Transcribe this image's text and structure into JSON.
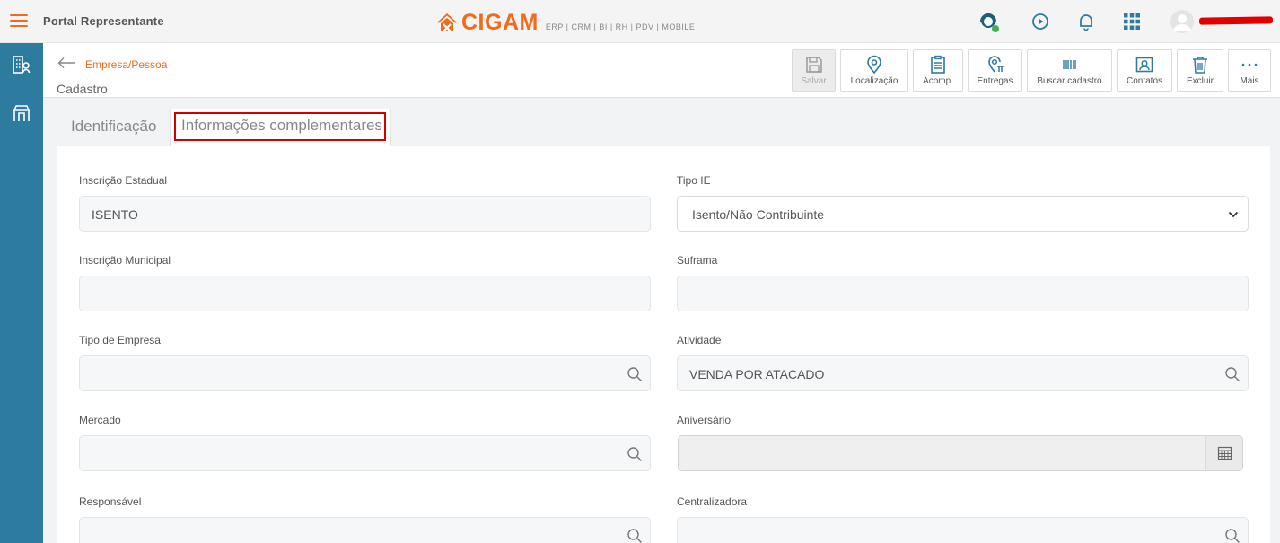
{
  "app": {
    "title": "Portal Representante",
    "logo_text": "CIGAM",
    "logo_sub": "ERP | CRM | BI | RH | PDV | MOBILE",
    "brand_color": "#f26a1b",
    "sidebar_color": "#2d7ca0"
  },
  "header": {
    "breadcrumb": "Empresa/Pessoa",
    "subtitle": "Cadastro"
  },
  "toolbar": {
    "save": "Salvar",
    "location": "Localização",
    "acomp": "Acomp.",
    "deliveries": "Entregas",
    "search_register": "Buscar cadastro",
    "contacts": "Contatos",
    "delete": "Excluir",
    "more": "Mais"
  },
  "tabs": {
    "identification": "Identificação",
    "complementary": "Informações complementares"
  },
  "form": {
    "inscricao_estadual": {
      "label": "Inscrição Estadual",
      "value": "ISENTO"
    },
    "tipo_ie": {
      "label": "Tipo IE",
      "value": "Isento/Não Contribuinte"
    },
    "inscricao_municipal": {
      "label": "Inscrição Municipal",
      "value": ""
    },
    "suframa": {
      "label": "Suframa",
      "value": ""
    },
    "tipo_empresa": {
      "label": "Tipo de Empresa",
      "value": ""
    },
    "atividade": {
      "label": "Atividade",
      "value": "VENDA POR ATACADO"
    },
    "mercado": {
      "label": "Mercado",
      "value": ""
    },
    "aniversario": {
      "label": "Aniversário",
      "value": ""
    },
    "responsavel": {
      "label": "Responsável",
      "value": ""
    },
    "centralizadora": {
      "label": "Centralizadora",
      "value": ""
    }
  }
}
